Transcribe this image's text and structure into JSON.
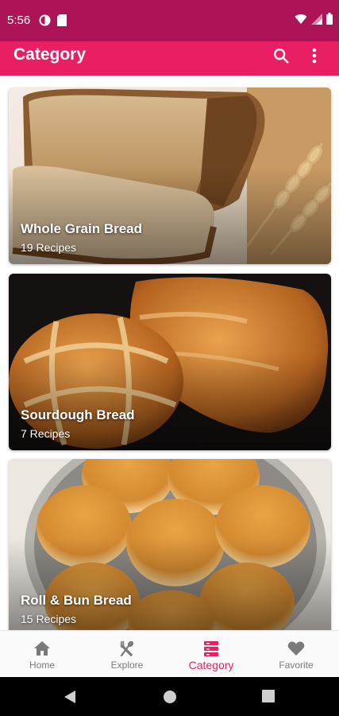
{
  "status_bar": {
    "time": "5:56"
  },
  "app_bar": {
    "title": "Category"
  },
  "categories": [
    {
      "name": "Whole Grain Bread",
      "count": "19 Recipes"
    },
    {
      "name": "Sourdough Bread",
      "count": "7 Recipes"
    },
    {
      "name": "Roll & Bun Bread",
      "count": "15 Recipes"
    }
  ],
  "bottom_nav": {
    "items": [
      {
        "label": "Home",
        "icon": "home-icon"
      },
      {
        "label": "Explore",
        "icon": "fork-spoon-icon"
      },
      {
        "label": "Category",
        "icon": "category-icon"
      },
      {
        "label": "Favorite",
        "icon": "heart-icon"
      }
    ],
    "active": "Category"
  },
  "colors": {
    "status_bar": "#ad1457",
    "app_bar": "#e91e63",
    "accent": "#e91e63",
    "nav_inactive": "#7a7a7a"
  }
}
